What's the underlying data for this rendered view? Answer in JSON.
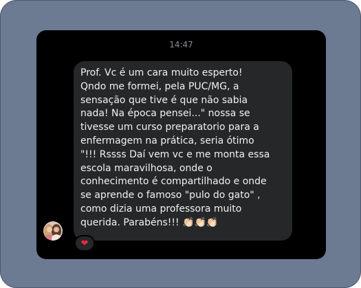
{
  "chat": {
    "timestamp": "14:47",
    "message": {
      "text": "Prof. Vc é um cara muito esperto!\nQndo me formei, pela PUC/MG, a\nsensação que tive é que não sabia\nnada! Na época pensei...\" nossa se\ntivesse um curso preparatorio para a\nenfermagem na prática, seria ótimo\n\"!!! Rssss Daí vem vc e me monta essa\nescola maravilhosa, onde o\nconhecimento é compartilhado e onde\nse aprende o famoso  \"pulo do gato\" ,\ncomo dizia uma professora muito\nquerida. Parabéns!!! 👏🏻👏🏻👏🏻"
    },
    "reaction": {
      "emoji": "❤",
      "color": "#ed2a3b"
    },
    "colors": {
      "frame_background": "#6c7a92",
      "chat_background": "#000000",
      "bubble_background": "#262729",
      "message_text": "#f2f2f2",
      "timestamp_text": "#8e8e93"
    }
  }
}
